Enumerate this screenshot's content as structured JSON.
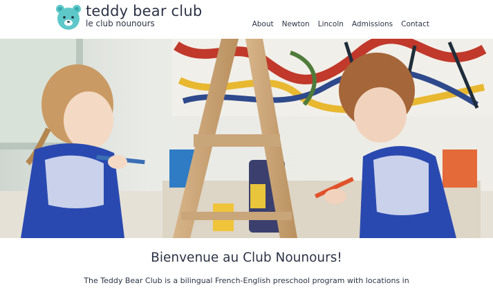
{
  "brand": {
    "name": "teddy bear club",
    "tagline": "le club nounours",
    "logo_icon": "teddy-bear-face-icon",
    "logo_color": "#5ec8c9"
  },
  "nav": {
    "items": [
      {
        "label": "About"
      },
      {
        "label": "Newton"
      },
      {
        "label": "Lincoln"
      },
      {
        "label": "Admissions"
      },
      {
        "label": "Contact"
      }
    ]
  },
  "hero": {
    "image": "photo-children-painting-at-easel"
  },
  "content": {
    "heading": "Bienvenue au Club Nounours!",
    "intro": "The Teddy Bear Club is a bilingual French-English preschool program with locations in"
  },
  "colors": {
    "text": "#2c3345",
    "accent": "#5ec8c9"
  }
}
